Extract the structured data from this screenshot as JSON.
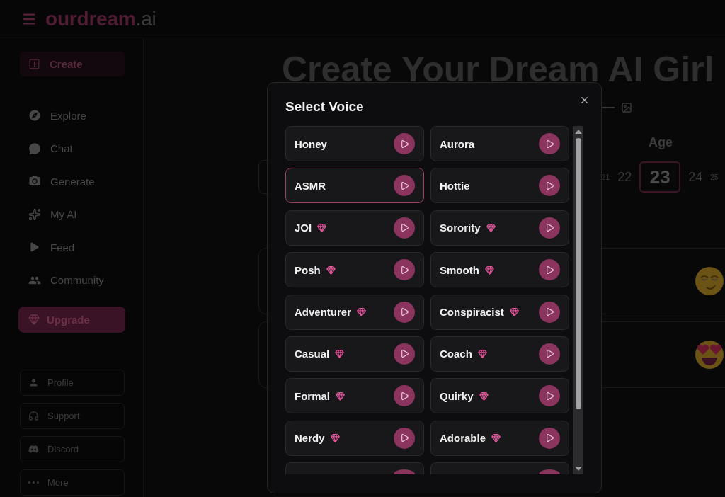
{
  "header": {
    "logo": {
      "name": "ourdream",
      "suffix": ".ai"
    }
  },
  "sidebar": {
    "create_button": {
      "label": "Create",
      "selected": true
    },
    "nav_items": [
      {
        "label": "Explore",
        "selected": false
      },
      {
        "label": "Chat",
        "selected": false
      },
      {
        "label": "Generate",
        "selected": false
      },
      {
        "label": "My AI",
        "selected": false
      },
      {
        "label": "Feed",
        "selected": false
      },
      {
        "label": "Community",
        "selected": false
      }
    ],
    "upgrade_button": {
      "label": "Upgrade"
    },
    "footer_links": [
      {
        "label": "Profile"
      },
      {
        "label": "Support"
      },
      {
        "label": "Discord"
      },
      {
        "label": "More"
      }
    ]
  },
  "page": {
    "heading": "Create Your Dream AI Girl",
    "age": {
      "label": "Age",
      "values": [
        {
          "value": "21",
          "selected": false
        },
        {
          "value": "22",
          "selected": false
        },
        {
          "value": "23",
          "selected": true
        },
        {
          "value": "24",
          "selected": false
        },
        {
          "value": "25",
          "selected": false
        }
      ]
    },
    "personality_cards": [
      {
        "kind": "relieved"
      },
      {
        "kind": "heart-eyes"
      }
    ]
  },
  "voice_dialog": {
    "title": "Select Voice",
    "voices": [
      {
        "kind": "voice",
        "label": "Honey",
        "premium": false,
        "selected": false
      },
      {
        "kind": "voice",
        "label": "Aurora",
        "premium": false,
        "selected": false
      },
      {
        "kind": "voice",
        "label": "ASMR",
        "premium": false,
        "selected": true
      },
      {
        "kind": "voice",
        "label": "Hottie",
        "premium": false,
        "selected": false
      },
      {
        "kind": "voice",
        "label": "JOI",
        "premium": true,
        "selected": false
      },
      {
        "kind": "voice",
        "label": "Sorority",
        "premium": true,
        "selected": false
      },
      {
        "kind": "voice",
        "label": "Posh",
        "premium": true,
        "selected": false
      },
      {
        "kind": "voice",
        "label": "Smooth",
        "premium": true,
        "selected": false
      },
      {
        "kind": "voice",
        "label": "Adventurer",
        "premium": true,
        "selected": false
      },
      {
        "kind": "voice",
        "label": "Conspiracist",
        "premium": true,
        "selected": false
      },
      {
        "kind": "voice",
        "label": "Casual",
        "premium": true,
        "selected": false
      },
      {
        "kind": "voice",
        "label": "Coach",
        "premium": true,
        "selected": false
      },
      {
        "kind": "voice",
        "label": "Formal",
        "premium": true,
        "selected": false
      },
      {
        "kind": "voice",
        "label": "Quirky",
        "premium": true,
        "selected": false
      },
      {
        "kind": "voice",
        "label": "Nerdy",
        "premium": true,
        "selected": false
      },
      {
        "kind": "voice",
        "label": "Adorable",
        "premium": true,
        "selected": false
      },
      {
        "kind": "cut-off",
        "selected": false
      },
      {
        "kind": "cut-off",
        "selected": false
      }
    ]
  }
}
